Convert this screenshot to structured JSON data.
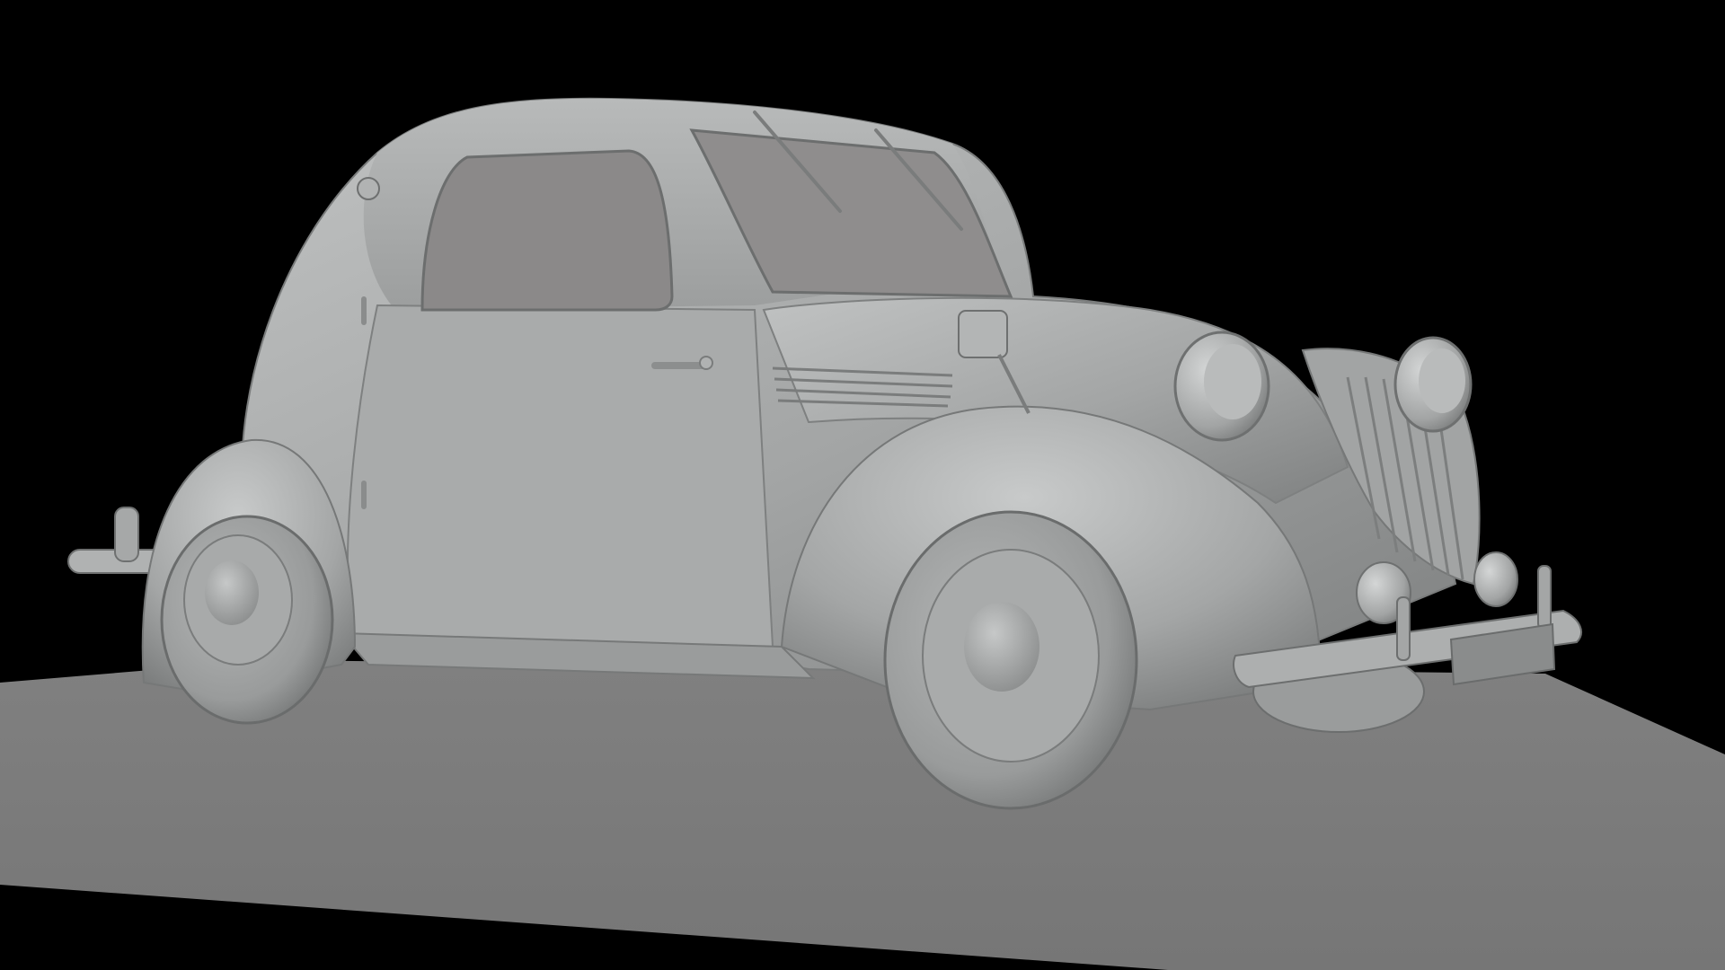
{
  "viewport": {
    "background_color": "#000000",
    "description_visible_text": ""
  },
  "scene": {
    "subject_icon": "vintage-car-render-icon",
    "colors": {
      "ground_plane": "#7d7d7d",
      "car_body": "#a6a8a8",
      "car_highlight": "#c4c6c6",
      "car_shadow": "#6f7171",
      "windows": "#8a8888",
      "tyre": "#9ea0a0"
    }
  }
}
